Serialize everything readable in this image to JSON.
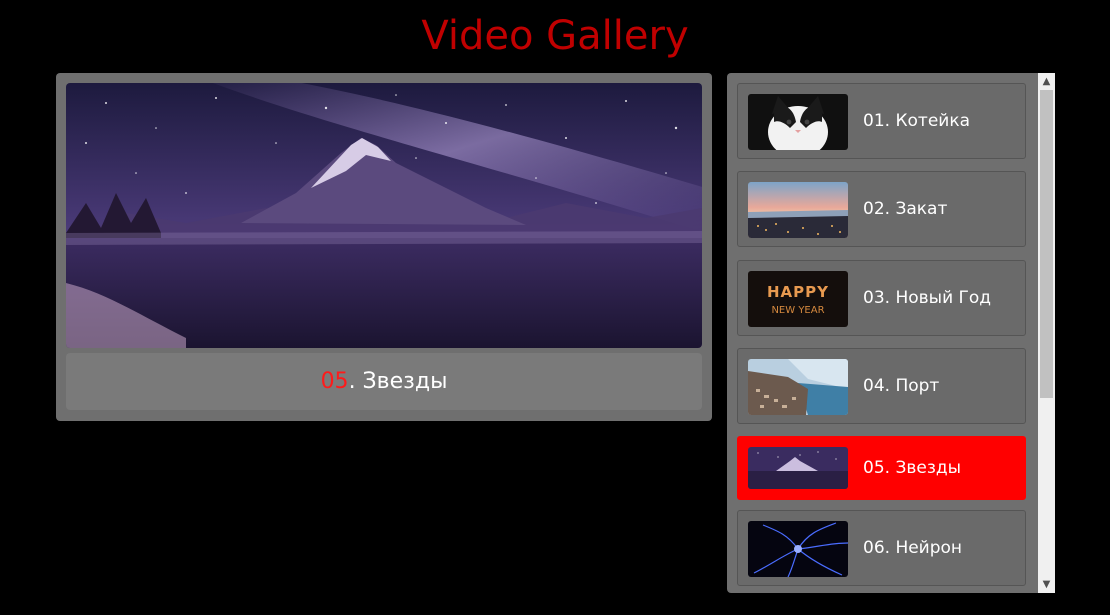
{
  "page": {
    "title": "Video Gallery"
  },
  "player": {
    "current_number": "05",
    "current_title": ". Звезды",
    "image": "starry-mountain-lake-night"
  },
  "playlist": {
    "items": [
      {
        "label": "01. Котейка",
        "thumbnail": "black-white-cat",
        "active": false
      },
      {
        "label": "02. Закат",
        "thumbnail": "sunset-coastal-town",
        "active": false
      },
      {
        "label": "03. Новый Год",
        "thumbnail": "happy-new-year-sparklers",
        "thumb_text_1": "HAPPY",
        "thumb_text_2": "NEW YEAR",
        "active": false
      },
      {
        "label": "04. Порт",
        "thumbnail": "port-town-aerial",
        "active": false
      },
      {
        "label": "05. Звезды",
        "thumbnail": "starry-mountain-lake-night",
        "active": true
      },
      {
        "label": "06. Нейрон",
        "thumbnail": "blue-neuron",
        "active": false
      }
    ],
    "scrollbar": {
      "up_icon": "chevron-up-icon",
      "down_icon": "chevron-down-icon"
    }
  },
  "colors": {
    "title": "#c00000",
    "active_item": "#ff0000",
    "panel": "#6f6f6f",
    "background": "#000000"
  }
}
